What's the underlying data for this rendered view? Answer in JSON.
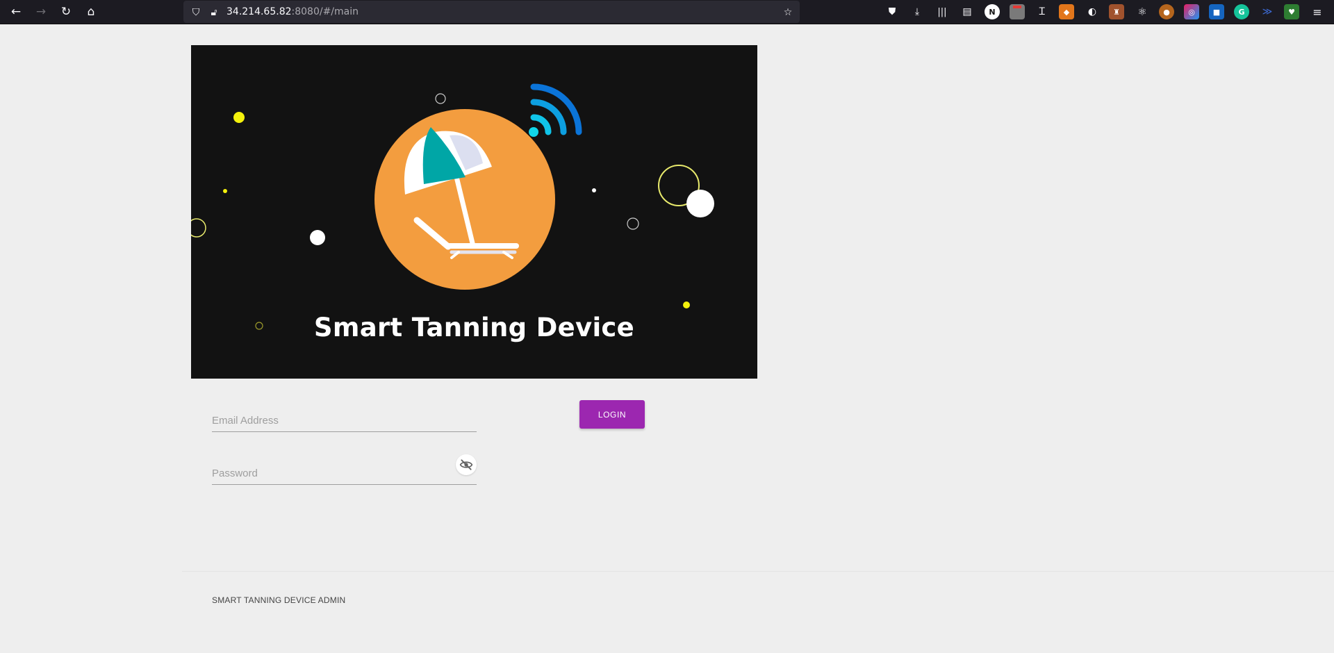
{
  "browser": {
    "url_host": "34.214.65.82",
    "url_path": ":8080/#/main",
    "nav": {
      "back_icon": "back-arrow-icon",
      "forward_icon": "forward-arrow-icon",
      "reload_icon": "reload-icon",
      "home_icon": "home-icon"
    },
    "extensions": [
      "pocket-icon",
      "downloads-icon",
      "library-icon",
      "reader-view-icon",
      "notion-icon",
      "extension-badge-icon",
      "translate-icon",
      "metamask-icon",
      "ublock-icon",
      "castle-icon",
      "react-icon",
      "cookie-icon",
      "color-icon",
      "save-icon",
      "grammarly-icon",
      "bookmark-icon",
      "shield-icon",
      "menu-icon"
    ],
    "notion_label": "N",
    "grammarly_label": "G"
  },
  "hero": {
    "title": "Smart Tanning Device",
    "background": "#121212",
    "sun_color": "#f39d3f",
    "umbrella_color": "#00a6a6",
    "wifi_colors": [
      "#11d6e8",
      "#0b74d8"
    ]
  },
  "form": {
    "email_placeholder": "Email Address",
    "password_placeholder": "Password",
    "login_label": "LOGIN",
    "accent": "#9c27b0"
  },
  "footer": {
    "text": "SMART TANNING DEVICE ADMIN"
  }
}
